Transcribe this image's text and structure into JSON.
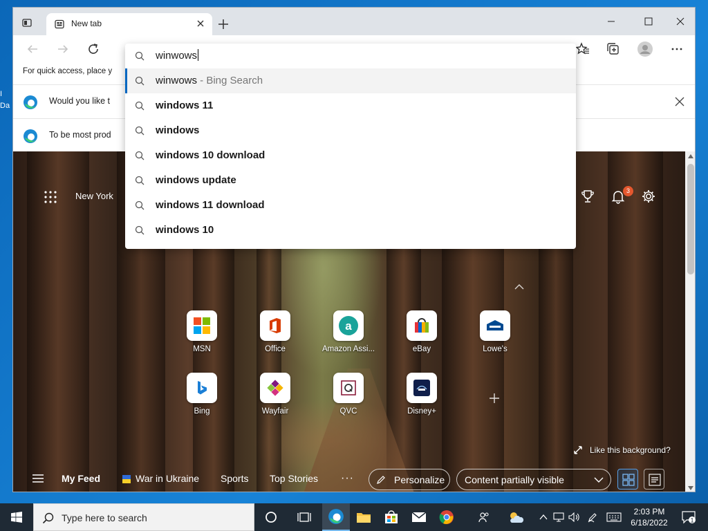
{
  "desktop": {
    "fragment_lines": [
      "I",
      "Da"
    ]
  },
  "tab": {
    "title": "New tab"
  },
  "favorites_bar": {
    "text": "For quick access, place y"
  },
  "infobars": [
    {
      "text": "Would you like t"
    },
    {
      "text": "To be most prod"
    }
  ],
  "omnibox": {
    "query": "winwows",
    "suggestions": [
      {
        "text": "winwows",
        "suffix": " - Bing Search",
        "bold": false,
        "selected": true
      },
      {
        "text": "windows 11",
        "suffix": "",
        "bold": true,
        "selected": false
      },
      {
        "text": "windows",
        "suffix": "",
        "bold": true,
        "selected": false
      },
      {
        "text": "windows 10 download",
        "suffix": "",
        "bold": true,
        "selected": false
      },
      {
        "text": "windows update",
        "suffix": "",
        "bold": true,
        "selected": false
      },
      {
        "text": "windows 11 download",
        "suffix": "",
        "bold": true,
        "selected": false
      },
      {
        "text": "windows 10",
        "suffix": "",
        "bold": true,
        "selected": false
      }
    ]
  },
  "newtab": {
    "weather_location": "New York",
    "notification_count": "3",
    "quick_links": [
      {
        "label": "MSN",
        "icon": "msn-logo-icon"
      },
      {
        "label": "Office",
        "icon": "office-logo-icon"
      },
      {
        "label": "Amazon Assi...",
        "icon": "amazon-assistant-icon"
      },
      {
        "label": "eBay",
        "icon": "ebay-bag-icon"
      },
      {
        "label": "Lowe's",
        "icon": "lowes-logo-icon"
      },
      {
        "label": "Bing",
        "icon": "bing-logo-icon"
      },
      {
        "label": "Wayfair",
        "icon": "wayfair-logo-icon"
      },
      {
        "label": "QVC",
        "icon": "qvc-logo-icon"
      },
      {
        "label": "Disney+",
        "icon": "disney-plus-icon"
      }
    ],
    "like_background": "Like this background?",
    "feed": {
      "items": [
        "My Feed",
        "War in Ukraine",
        "Sports",
        "Top Stories"
      ],
      "more": "···",
      "personalize": "Personalize",
      "content_visibility": "Content partially visible"
    }
  },
  "taskbar": {
    "search_placeholder": "Type here to search",
    "time": "2:03 PM",
    "date": "6/18/2022",
    "notification_count": "1"
  },
  "colors": {
    "accent": "#0067c0",
    "taskbar": "#1f2a35",
    "badge": "#e4572e",
    "desktop": "#1883d7"
  }
}
